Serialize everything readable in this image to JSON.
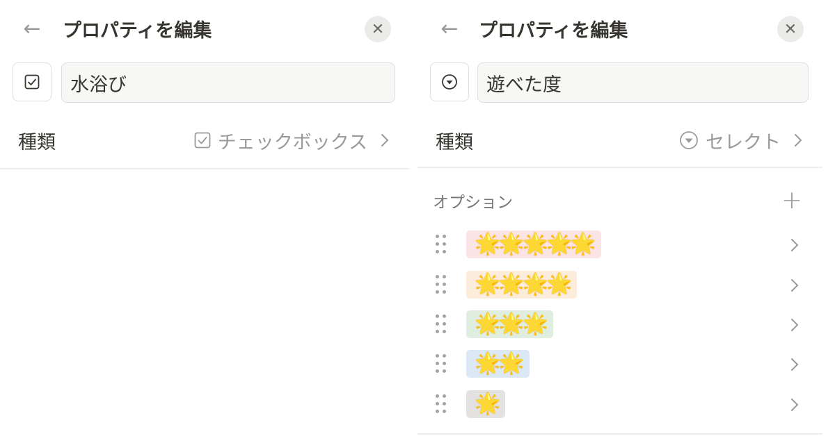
{
  "left_panel": {
    "back_icon": "arrow-left-icon",
    "title": "プロパティを編集",
    "close_icon": "close-icon",
    "property_icon": "checkbox-icon",
    "property_name": "水浴び",
    "type_label": "種類",
    "type_value": "チェックボックス",
    "type_value_icon": "checkbox-icon"
  },
  "right_panel": {
    "back_icon": "arrow-left-icon",
    "title": "プロパティを編集",
    "close_icon": "close-icon",
    "property_icon": "select-icon",
    "property_name": "遊べた度",
    "type_label": "種類",
    "type_value": "セレクト",
    "type_value_icon": "select-icon",
    "options_label": "オプション",
    "add_icon": "plus-icon",
    "options": [
      {
        "label": "🌟🌟🌟🌟🌟",
        "color": "#fbe4e4"
      },
      {
        "label": "🌟🌟🌟🌟",
        "color": "#fbecdc"
      },
      {
        "label": "🌟🌟🌟",
        "color": "#e0eedf"
      },
      {
        "label": "🌟🌟",
        "color": "#dce8f3"
      },
      {
        "label": "🌟",
        "color": "#e3e2e0"
      }
    ]
  },
  "colors": {
    "text": "#37352f",
    "muted": "#9b9a97",
    "input_bg": "#f7f7f5",
    "border": "#dfdfde"
  }
}
